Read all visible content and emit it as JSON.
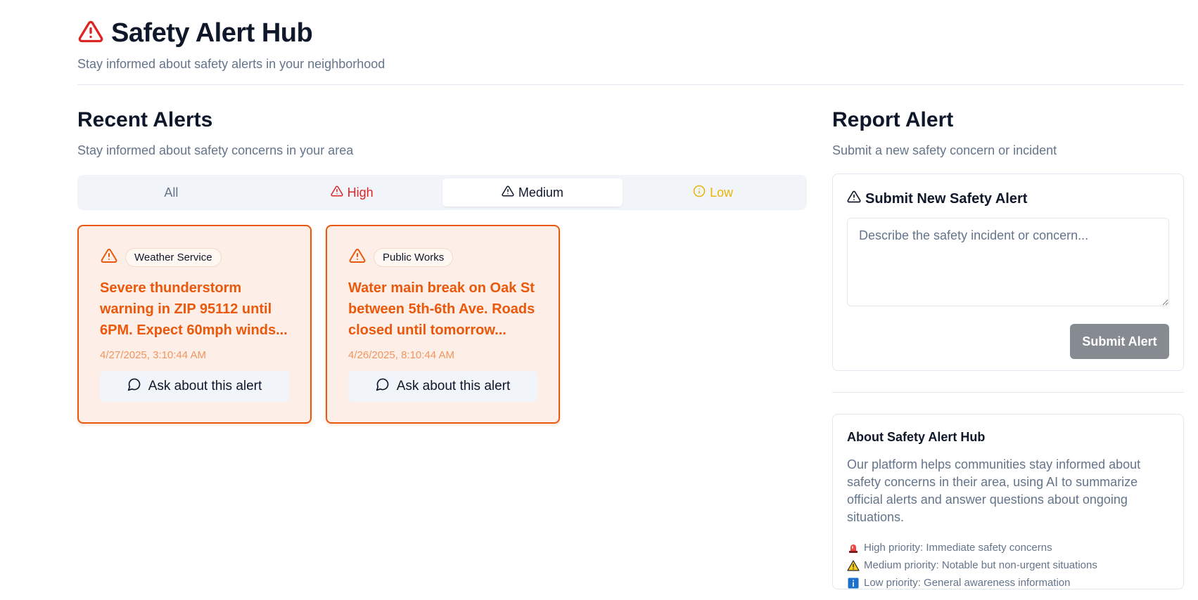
{
  "header": {
    "title": "Safety Alert Hub",
    "subtitle": "Stay informed about safety alerts in your neighborhood"
  },
  "recent": {
    "title": "Recent Alerts",
    "subtitle": "Stay informed about safety concerns in your area",
    "tabs": [
      {
        "label": "All",
        "icon": "none"
      },
      {
        "label": "High",
        "icon": "warning-triangle-icon"
      },
      {
        "label": "Medium",
        "icon": "warning-triangle-icon"
      },
      {
        "label": "Low",
        "icon": "info-circle-icon"
      }
    ],
    "active_tab": "Medium",
    "alerts": [
      {
        "source": "Weather Service",
        "text": "Severe thunderstorm warning in ZIP 95112 until 6PM. Expect 60mph winds...",
        "time": "4/27/2025, 3:10:44 AM",
        "button": "Ask about this alert"
      },
      {
        "source": "Public Works",
        "text": "Water main break on Oak St between 5th-6th Ave. Roads closed until tomorrow...",
        "time": "4/26/2025, 8:10:44 AM",
        "button": "Ask about this alert"
      }
    ]
  },
  "report": {
    "title": "Report Alert",
    "subtitle": "Submit a new safety concern or incident",
    "form_title": "Submit New Safety Alert",
    "placeholder": "Describe the safety incident or concern...",
    "submit_label": "Submit Alert"
  },
  "about": {
    "title": "About Safety Alert Hub",
    "text": "Our platform helps communities stay informed about safety concerns in their area, using AI to summarize official alerts and answer questions about ongoing situations.",
    "legend": [
      {
        "icon": "siren-icon",
        "label": "High priority: Immediate safety concerns"
      },
      {
        "icon": "warning-emoji-icon",
        "label": "Medium priority: Notable but non-urgent situations"
      },
      {
        "icon": "info-emoji-icon",
        "label": "Low priority: General awareness information"
      }
    ]
  },
  "colors": {
    "high": "#dc2626",
    "medium": "#ea580c",
    "low": "#eab308",
    "muted": "#64748b",
    "submit_disabled": "#868a91"
  }
}
